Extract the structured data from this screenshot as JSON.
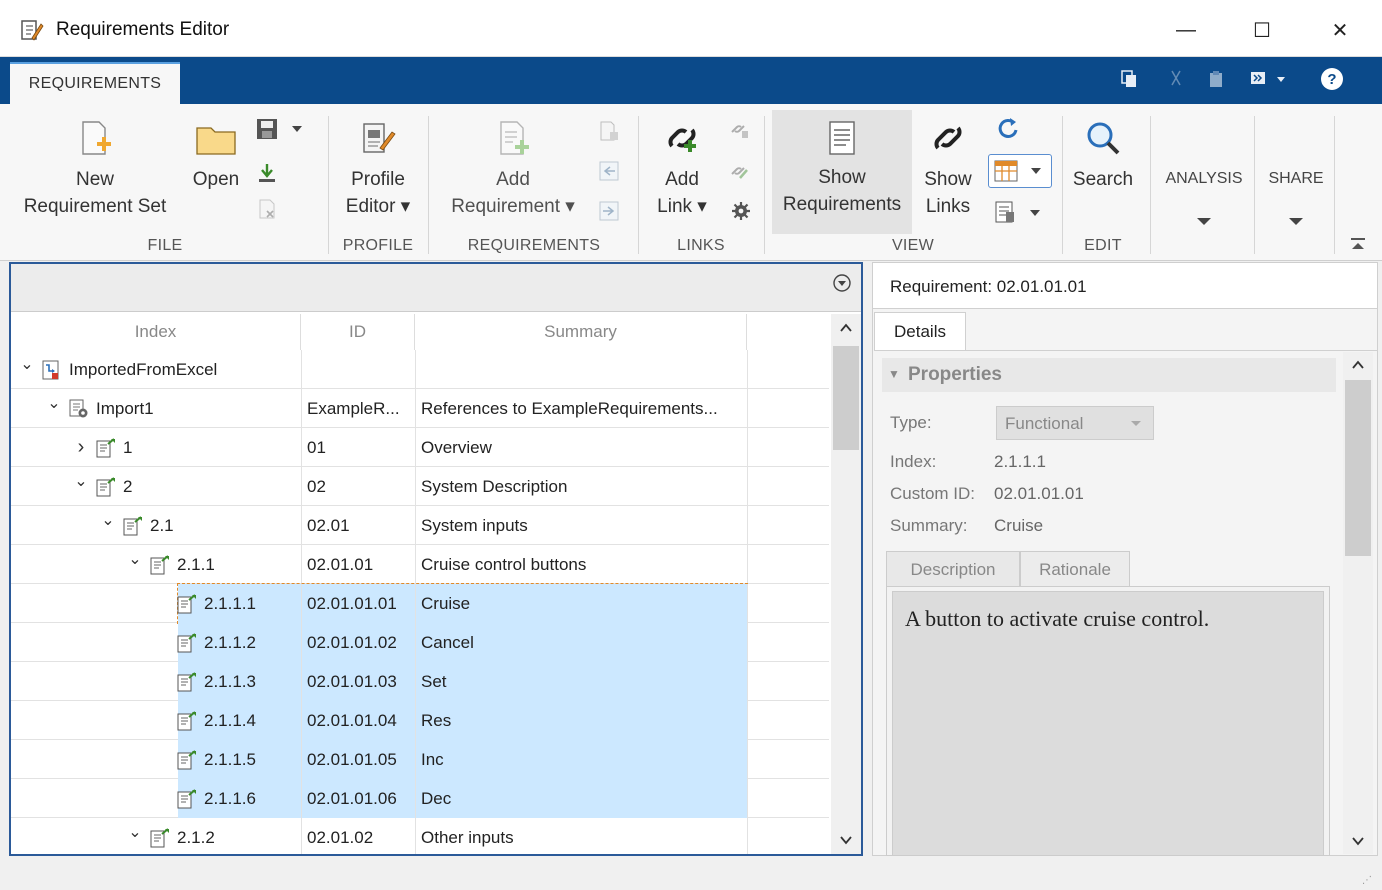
{
  "window": {
    "title": "Requirements Editor",
    "minimize": "—",
    "maximize": "☐",
    "close": "✕"
  },
  "tabs": [
    {
      "label": "REQUIREMENTS"
    }
  ],
  "ribbon": {
    "file": {
      "group_label": "FILE",
      "new_line1": "New",
      "new_line2": "Requirement Set",
      "open_label": "Open"
    },
    "profile": {
      "group_label": "PROFILE",
      "line1": "Profile",
      "line2": "Editor ▾"
    },
    "requirements": {
      "group_label": "REQUIREMENTS",
      "line1": "Add",
      "line2": "Requirement ▾"
    },
    "links": {
      "group_label": "LINKS",
      "line1": "Add",
      "line2": "Link ▾"
    },
    "view": {
      "group_label": "VIEW",
      "show_req_line1": "Show",
      "show_req_line2": "Requirements",
      "show_links_line1": "Show",
      "show_links_line2": "Links"
    },
    "edit": {
      "group_label": "EDIT",
      "search_label": "Search"
    },
    "analysis": {
      "label": "ANALYSIS"
    },
    "share": {
      "label": "SHARE"
    }
  },
  "tree": {
    "columns": [
      "Index",
      "ID",
      "Summary"
    ],
    "rows": [
      {
        "index": "ImportedFromExcel",
        "id": "",
        "summary": "",
        "level": 0,
        "expander": "⌄",
        "icon": "reqset-icon",
        "selected": false
      },
      {
        "index": "Import1",
        "id": "ExampleR...",
        "summary": "References to ExampleRequirements...",
        "level": 1,
        "expander": "⌄",
        "icon": "import-icon",
        "selected": false
      },
      {
        "index": "1",
        "id": "01",
        "summary": "Overview",
        "level": 2,
        "expander": "›",
        "icon": "requirement-icon",
        "selected": false
      },
      {
        "index": "2",
        "id": "02",
        "summary": "System Description",
        "level": 2,
        "expander": "⌄",
        "icon": "requirement-icon",
        "selected": false
      },
      {
        "index": "2.1",
        "id": "02.01",
        "summary": "System inputs",
        "level": 3,
        "expander": "⌄",
        "icon": "requirement-icon",
        "selected": false
      },
      {
        "index": "2.1.1",
        "id": "02.01.01",
        "summary": "Cruise control buttons",
        "level": 4,
        "expander": "⌄",
        "icon": "requirement-icon",
        "selected": false
      },
      {
        "index": "2.1.1.1",
        "id": "02.01.01.01",
        "summary": "Cruise",
        "level": 5,
        "expander": "",
        "icon": "requirement-icon",
        "selected": true
      },
      {
        "index": "2.1.1.2",
        "id": "02.01.01.02",
        "summary": "Cancel",
        "level": 5,
        "expander": "",
        "icon": "requirement-icon",
        "selected": true
      },
      {
        "index": "2.1.1.3",
        "id": "02.01.01.03",
        "summary": "Set",
        "level": 5,
        "expander": "",
        "icon": "requirement-icon",
        "selected": true
      },
      {
        "index": "2.1.1.4",
        "id": "02.01.01.04",
        "summary": "Res",
        "level": 5,
        "expander": "",
        "icon": "requirement-icon",
        "selected": true
      },
      {
        "index": "2.1.1.5",
        "id": "02.01.01.05",
        "summary": "Inc",
        "level": 5,
        "expander": "",
        "icon": "requirement-icon",
        "selected": true
      },
      {
        "index": "2.1.1.6",
        "id": "02.01.01.06",
        "summary": "Dec",
        "level": 5,
        "expander": "",
        "icon": "requirement-icon",
        "selected": true
      },
      {
        "index": "2.1.2",
        "id": "02.01.02",
        "summary": "Other inputs",
        "level": 4,
        "expander": "⌄",
        "icon": "requirement-icon",
        "selected": false
      }
    ]
  },
  "details": {
    "header": "Requirement: 02.01.01.01",
    "tab_label": "Details",
    "section_title": "Properties",
    "type_label": "Type:",
    "type_value": "Functional",
    "index_label": "Index:",
    "index_value": "2.1.1.1",
    "custom_id_label": "Custom ID:",
    "custom_id_value": "02.01.01.01",
    "summary_label": "Summary:",
    "summary_value": "Cruise",
    "desc_tabs": [
      "Description",
      "Rationale"
    ],
    "description_text": "A button to activate cruise control."
  },
  "colors": {
    "tabstrip": "#0b4a8a",
    "selection": "#cce8ff",
    "pane_border": "#2b5a99"
  }
}
